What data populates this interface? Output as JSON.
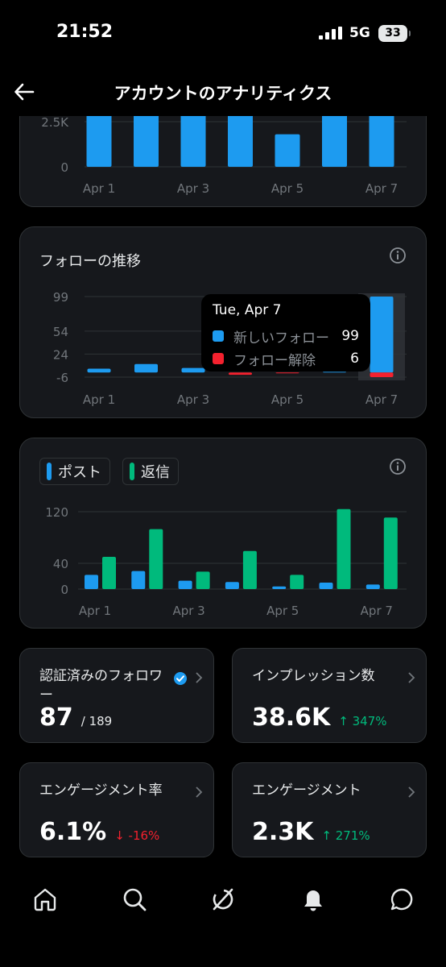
{
  "status": {
    "time": "21:52",
    "network": "5G",
    "battery": "33"
  },
  "header": {
    "title": "アカウントのアナリティクス"
  },
  "impressions_chart": {
    "chart_data": {
      "type": "bar",
      "categories": [
        "Apr 1",
        "Apr 2",
        "Apr 3",
        "Apr 4",
        "Apr 5",
        "Apr 6",
        "Apr 7"
      ],
      "visible_x_labels": [
        "Apr 1",
        "Apr 3",
        "Apr 5",
        "Apr 7"
      ],
      "y_ticks": [
        "2.5K",
        "0"
      ],
      "y_tick_values": [
        2500,
        0
      ],
      "values": [
        4500,
        4500,
        4500,
        4500,
        1800,
        4500,
        4500
      ],
      "color": "#1d9bf0"
    }
  },
  "follow_chart": {
    "title": "フォローの推移",
    "chart_data": {
      "type": "bar",
      "categories": [
        "Apr 1",
        "Apr 2",
        "Apr 3",
        "Apr 4",
        "Apr 5",
        "Apr 6",
        "Apr 7"
      ],
      "visible_x_labels": [
        "Apr 1",
        "Apr 3",
        "Apr 5",
        "Apr 7"
      ],
      "y_ticks": [
        "99",
        "54",
        "24",
        "-6"
      ],
      "y_tick_values": [
        99,
        54,
        24,
        -6
      ],
      "series": [
        {
          "name": "新しいフォロー",
          "color": "#1d9bf0",
          "values": [
            5,
            11,
            6,
            0,
            0,
            1,
            99
          ]
        },
        {
          "name": "フォロー解除",
          "color": "#f4212e",
          "values": [
            0,
            0,
            0,
            -3,
            -1,
            0,
            -6
          ]
        }
      ],
      "highlighted_index": 6
    },
    "tooltip": {
      "date": "Tue, Apr 7",
      "rows": [
        {
          "label": "新しいフォロー",
          "value": "99",
          "color": "#1d9bf0"
        },
        {
          "label": "フォロー解除",
          "value": "6",
          "color": "#f4212e"
        }
      ]
    }
  },
  "post_reply_chart": {
    "legend": {
      "posts": "ポスト",
      "replies": "返信"
    },
    "chart_data": {
      "type": "bar",
      "categories": [
        "Apr 1",
        "Apr 2",
        "Apr 3",
        "Apr 4",
        "Apr 5",
        "Apr 6",
        "Apr 7"
      ],
      "visible_x_labels": [
        "Apr 1",
        "Apr 3",
        "Apr 5",
        "Apr 7"
      ],
      "y_ticks": [
        "120",
        "40",
        "0"
      ],
      "y_tick_values": [
        120,
        40,
        0
      ],
      "series": [
        {
          "name": "ポスト",
          "color": "#1d9bf0",
          "values": [
            22,
            28,
            13,
            11,
            4,
            10,
            7
          ]
        },
        {
          "name": "返信",
          "color": "#00ba7c",
          "values": [
            50,
            93,
            27,
            59,
            22,
            124,
            111
          ]
        }
      ]
    }
  },
  "stats": {
    "verified_followers": {
      "label": "認証済みのフォロワー",
      "value": "87",
      "total": "/ 189"
    },
    "impressions": {
      "label": "インプレッション数",
      "value": "38.6K",
      "change": "↑ 347%"
    },
    "engagement_rate": {
      "label": "エンゲージメント率",
      "value": "6.1%",
      "change": "↓ -16%"
    },
    "engagements": {
      "label": "エンゲージメント",
      "value": "2.3K",
      "change": "↑ 271%"
    }
  },
  "tabbar": {
    "items": [
      "home-icon",
      "search-icon",
      "grok-icon",
      "notifications-icon",
      "messages-icon"
    ]
  }
}
